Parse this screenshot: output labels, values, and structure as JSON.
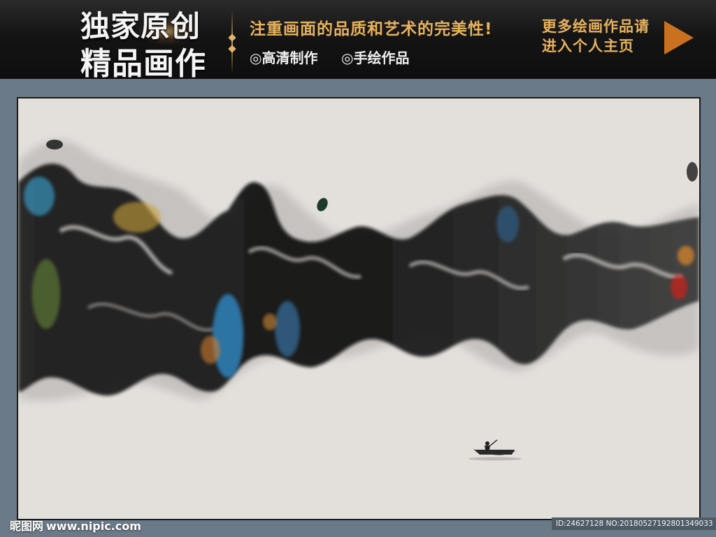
{
  "banner": {
    "title_line1": "独家原创",
    "title_line2": "精品画作",
    "slogan": "注重画面的品质和艺术的完美性!",
    "feature1": "◎高清制作",
    "feature2": "◎手绘作品",
    "more_line1": "更多绘画作品请",
    "more_line2": "进入个人主页",
    "accent_color": "#e7b25e",
    "arrow_color": "#c9711f"
  },
  "footer": {
    "logo_text": "昵图网",
    "site_url": "www.nipic.com",
    "image_id": "ID:24627128 NO:20180527192801349033"
  },
  "artwork": {
    "background_color": "#e3e0dc",
    "ink_color": "#111111"
  }
}
